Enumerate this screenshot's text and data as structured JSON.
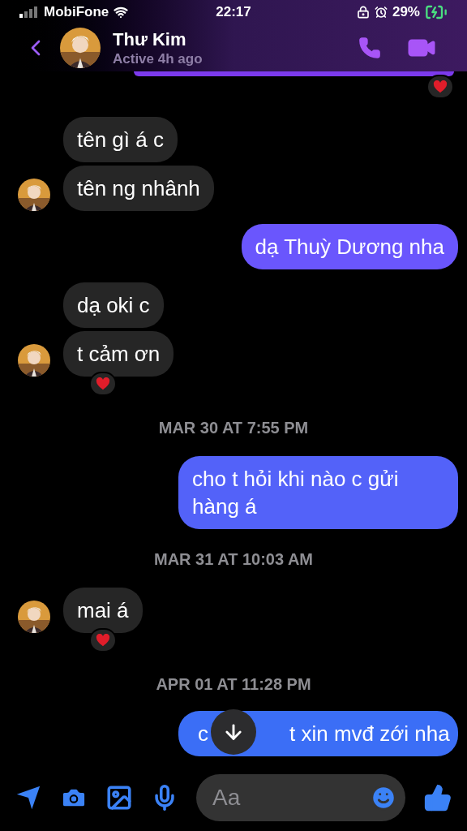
{
  "status_bar": {
    "carrier": "MobiFone",
    "time": "22:17",
    "battery": "29%"
  },
  "header": {
    "name": "Thư Kim",
    "status": "Active 4h ago"
  },
  "messages": [
    {
      "kind": "partial",
      "reacted": true
    },
    {
      "kind": "received",
      "text": "tên gì á c",
      "reacted": false,
      "avatar": false
    },
    {
      "kind": "received",
      "text": "tên ng nhânh",
      "reacted": false,
      "avatar": true
    },
    {
      "kind": "sent",
      "text": "dạ Thuỳ Dương nha",
      "reacted": false
    },
    {
      "kind": "received",
      "text": "dạ oki c",
      "reacted": false,
      "avatar": false
    },
    {
      "kind": "received",
      "text": "t cảm ơn",
      "reacted": true,
      "avatar": true
    },
    {
      "kind": "timestamp",
      "text": "MAR 30 AT 7:55 PM"
    },
    {
      "kind": "sent",
      "text": "cho t hỏi khi nào c gửi hàng á",
      "reacted": false
    },
    {
      "kind": "timestamp",
      "text": "MAR 31 AT 10:03 AM"
    },
    {
      "kind": "received",
      "text": "mai á",
      "reacted": true,
      "avatar": true
    },
    {
      "kind": "timestamp",
      "text": "APR 01 AT 11:28 PM"
    },
    {
      "kind": "sent",
      "text_parts": [
        "c",
        "t xin mvđ zới nha"
      ],
      "reacted": false
    }
  ],
  "composer": {
    "placeholder": "Aa"
  }
}
